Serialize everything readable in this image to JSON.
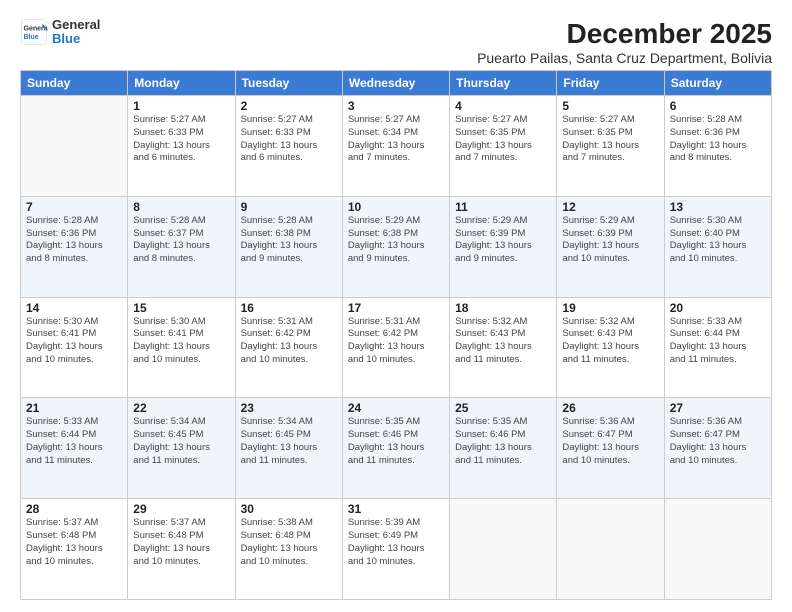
{
  "logo": {
    "general": "General",
    "blue": "Blue"
  },
  "title": "December 2025",
  "subtitle": "Puearto Pailas, Santa Cruz Department, Bolivia",
  "days_of_week": [
    "Sunday",
    "Monday",
    "Tuesday",
    "Wednesday",
    "Thursday",
    "Friday",
    "Saturday"
  ],
  "weeks": [
    [
      {
        "day": "",
        "info": ""
      },
      {
        "day": "1",
        "info": "Sunrise: 5:27 AM\nSunset: 6:33 PM\nDaylight: 13 hours\nand 6 minutes."
      },
      {
        "day": "2",
        "info": "Sunrise: 5:27 AM\nSunset: 6:33 PM\nDaylight: 13 hours\nand 6 minutes."
      },
      {
        "day": "3",
        "info": "Sunrise: 5:27 AM\nSunset: 6:34 PM\nDaylight: 13 hours\nand 7 minutes."
      },
      {
        "day": "4",
        "info": "Sunrise: 5:27 AM\nSunset: 6:35 PM\nDaylight: 13 hours\nand 7 minutes."
      },
      {
        "day": "5",
        "info": "Sunrise: 5:27 AM\nSunset: 6:35 PM\nDaylight: 13 hours\nand 7 minutes."
      },
      {
        "day": "6",
        "info": "Sunrise: 5:28 AM\nSunset: 6:36 PM\nDaylight: 13 hours\nand 8 minutes."
      }
    ],
    [
      {
        "day": "7",
        "info": "Sunrise: 5:28 AM\nSunset: 6:36 PM\nDaylight: 13 hours\nand 8 minutes."
      },
      {
        "day": "8",
        "info": "Sunrise: 5:28 AM\nSunset: 6:37 PM\nDaylight: 13 hours\nand 8 minutes."
      },
      {
        "day": "9",
        "info": "Sunrise: 5:28 AM\nSunset: 6:38 PM\nDaylight: 13 hours\nand 9 minutes."
      },
      {
        "day": "10",
        "info": "Sunrise: 5:29 AM\nSunset: 6:38 PM\nDaylight: 13 hours\nand 9 minutes."
      },
      {
        "day": "11",
        "info": "Sunrise: 5:29 AM\nSunset: 6:39 PM\nDaylight: 13 hours\nand 9 minutes."
      },
      {
        "day": "12",
        "info": "Sunrise: 5:29 AM\nSunset: 6:39 PM\nDaylight: 13 hours\nand 10 minutes."
      },
      {
        "day": "13",
        "info": "Sunrise: 5:30 AM\nSunset: 6:40 PM\nDaylight: 13 hours\nand 10 minutes."
      }
    ],
    [
      {
        "day": "14",
        "info": "Sunrise: 5:30 AM\nSunset: 6:41 PM\nDaylight: 13 hours\nand 10 minutes."
      },
      {
        "day": "15",
        "info": "Sunrise: 5:30 AM\nSunset: 6:41 PM\nDaylight: 13 hours\nand 10 minutes."
      },
      {
        "day": "16",
        "info": "Sunrise: 5:31 AM\nSunset: 6:42 PM\nDaylight: 13 hours\nand 10 minutes."
      },
      {
        "day": "17",
        "info": "Sunrise: 5:31 AM\nSunset: 6:42 PM\nDaylight: 13 hours\nand 10 minutes."
      },
      {
        "day": "18",
        "info": "Sunrise: 5:32 AM\nSunset: 6:43 PM\nDaylight: 13 hours\nand 11 minutes."
      },
      {
        "day": "19",
        "info": "Sunrise: 5:32 AM\nSunset: 6:43 PM\nDaylight: 13 hours\nand 11 minutes."
      },
      {
        "day": "20",
        "info": "Sunrise: 5:33 AM\nSunset: 6:44 PM\nDaylight: 13 hours\nand 11 minutes."
      }
    ],
    [
      {
        "day": "21",
        "info": "Sunrise: 5:33 AM\nSunset: 6:44 PM\nDaylight: 13 hours\nand 11 minutes."
      },
      {
        "day": "22",
        "info": "Sunrise: 5:34 AM\nSunset: 6:45 PM\nDaylight: 13 hours\nand 11 minutes."
      },
      {
        "day": "23",
        "info": "Sunrise: 5:34 AM\nSunset: 6:45 PM\nDaylight: 13 hours\nand 11 minutes."
      },
      {
        "day": "24",
        "info": "Sunrise: 5:35 AM\nSunset: 6:46 PM\nDaylight: 13 hours\nand 11 minutes."
      },
      {
        "day": "25",
        "info": "Sunrise: 5:35 AM\nSunset: 6:46 PM\nDaylight: 13 hours\nand 11 minutes."
      },
      {
        "day": "26",
        "info": "Sunrise: 5:36 AM\nSunset: 6:47 PM\nDaylight: 13 hours\nand 10 minutes."
      },
      {
        "day": "27",
        "info": "Sunrise: 5:36 AM\nSunset: 6:47 PM\nDaylight: 13 hours\nand 10 minutes."
      }
    ],
    [
      {
        "day": "28",
        "info": "Sunrise: 5:37 AM\nSunset: 6:48 PM\nDaylight: 13 hours\nand 10 minutes."
      },
      {
        "day": "29",
        "info": "Sunrise: 5:37 AM\nSunset: 6:48 PM\nDaylight: 13 hours\nand 10 minutes."
      },
      {
        "day": "30",
        "info": "Sunrise: 5:38 AM\nSunset: 6:48 PM\nDaylight: 13 hours\nand 10 minutes."
      },
      {
        "day": "31",
        "info": "Sunrise: 5:39 AM\nSunset: 6:49 PM\nDaylight: 13 hours\nand 10 minutes."
      },
      {
        "day": "",
        "info": ""
      },
      {
        "day": "",
        "info": ""
      },
      {
        "day": "",
        "info": ""
      }
    ]
  ]
}
